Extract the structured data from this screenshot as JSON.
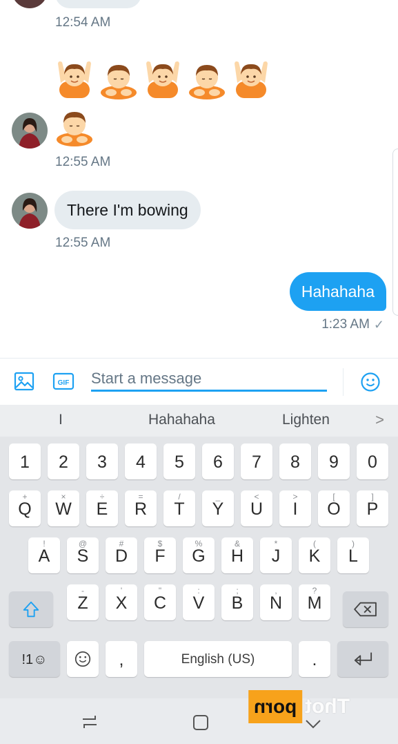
{
  "conversation": {
    "messages": [
      {
        "time": "12:54 AM"
      },
      {
        "emoji": [
          "person-raising-hands",
          "person-bowing",
          "person-raising-hands",
          "person-bowing",
          "person-raising-hands"
        ],
        "time": ""
      },
      {
        "emoji": [
          "person-bowing"
        ],
        "time": "12:55 AM"
      },
      {
        "text": "There I'm bowing",
        "time": "12:55 AM"
      },
      {
        "text": "Hahahaha",
        "time": "1:23 AM",
        "status": "✓"
      }
    ]
  },
  "composer": {
    "placeholder": "Start a message",
    "image_icon": "image-icon",
    "gif_label": "GIF",
    "emoji_icon": "smiley-icon"
  },
  "keyboard": {
    "suggestions": [
      "I",
      "Hahahaha",
      "Lighten"
    ],
    "suggest_arrow": ">",
    "numbers": [
      "1",
      "2",
      "3",
      "4",
      "5",
      "6",
      "7",
      "8",
      "9",
      "0"
    ],
    "row1": [
      {
        "k": "Q",
        "s": "+"
      },
      {
        "k": "W",
        "s": "×"
      },
      {
        "k": "E",
        "s": "÷"
      },
      {
        "k": "R",
        "s": "="
      },
      {
        "k": "T",
        "s": "/"
      },
      {
        "k": "Y",
        "s": "_"
      },
      {
        "k": "U",
        "s": "<"
      },
      {
        "k": "I",
        "s": ">"
      },
      {
        "k": "O",
        "s": "["
      },
      {
        "k": "P",
        "s": "]"
      }
    ],
    "row2": [
      {
        "k": "A",
        "s": "!"
      },
      {
        "k": "S",
        "s": "@"
      },
      {
        "k": "D",
        "s": "#"
      },
      {
        "k": "F",
        "s": "$"
      },
      {
        "k": "G",
        "s": "%"
      },
      {
        "k": "H",
        "s": "&"
      },
      {
        "k": "J",
        "s": "*"
      },
      {
        "k": "K",
        "s": "("
      },
      {
        "k": "L",
        "s": ")"
      }
    ],
    "row3": [
      {
        "k": "Z",
        "s": "-"
      },
      {
        "k": "X",
        "s": "'"
      },
      {
        "k": "C",
        "s": "\""
      },
      {
        "k": "V",
        "s": ":"
      },
      {
        "k": "B",
        "s": ";"
      },
      {
        "k": "N",
        "s": ","
      },
      {
        "k": "M",
        "s": "?"
      }
    ],
    "symbols_label": "!1☺",
    "comma": ",",
    "space_label": "English (US)",
    "period": "."
  },
  "watermark": {
    "box": "porn",
    "text": "Thot"
  },
  "colors": {
    "accent": "#1da1f2",
    "bubble_in": "#e6ecf0",
    "keyboard_bg": "#e3e5e8"
  }
}
